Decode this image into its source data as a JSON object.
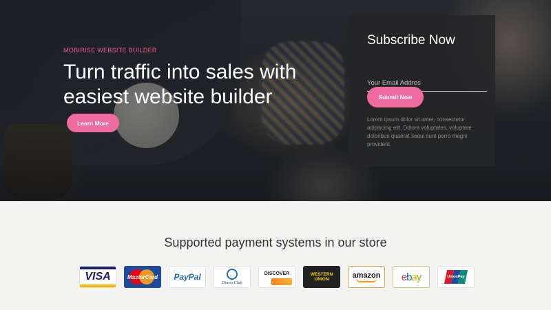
{
  "hero": {
    "eyebrow": "MOBIRISE WEBSITE BUILDER",
    "headline": "Turn traffic into sales with easiest website builder",
    "learn_more_label": "Learn More"
  },
  "subscribe": {
    "title": "Subscribe Now",
    "email_placeholder": "Your Email Addres",
    "submit_label": "Submit Now",
    "body": "Lorem ipsum dolor sit amet, consectetur adipiscing elit. Dolore voluptates, voluptate doloribus quaerat sequi sunt porro magni provident."
  },
  "payments": {
    "title": "Supported payment systems in our store",
    "logos": {
      "visa": "VISA",
      "mastercard": "MasterCard",
      "paypal": "PayPal",
      "diners": "Diners Club",
      "discover": "DISCOVER",
      "western_union_1": "WESTERN",
      "western_union_2": "UNION",
      "amazon": "amazon",
      "ebay_e": "e",
      "ebay_b": "b",
      "ebay_a": "a",
      "ebay_y": "y",
      "unionpay": "UnionPay"
    }
  },
  "colors": {
    "accent": "#f06ba0",
    "eyebrow": "#f06292",
    "panel": "#262628"
  }
}
